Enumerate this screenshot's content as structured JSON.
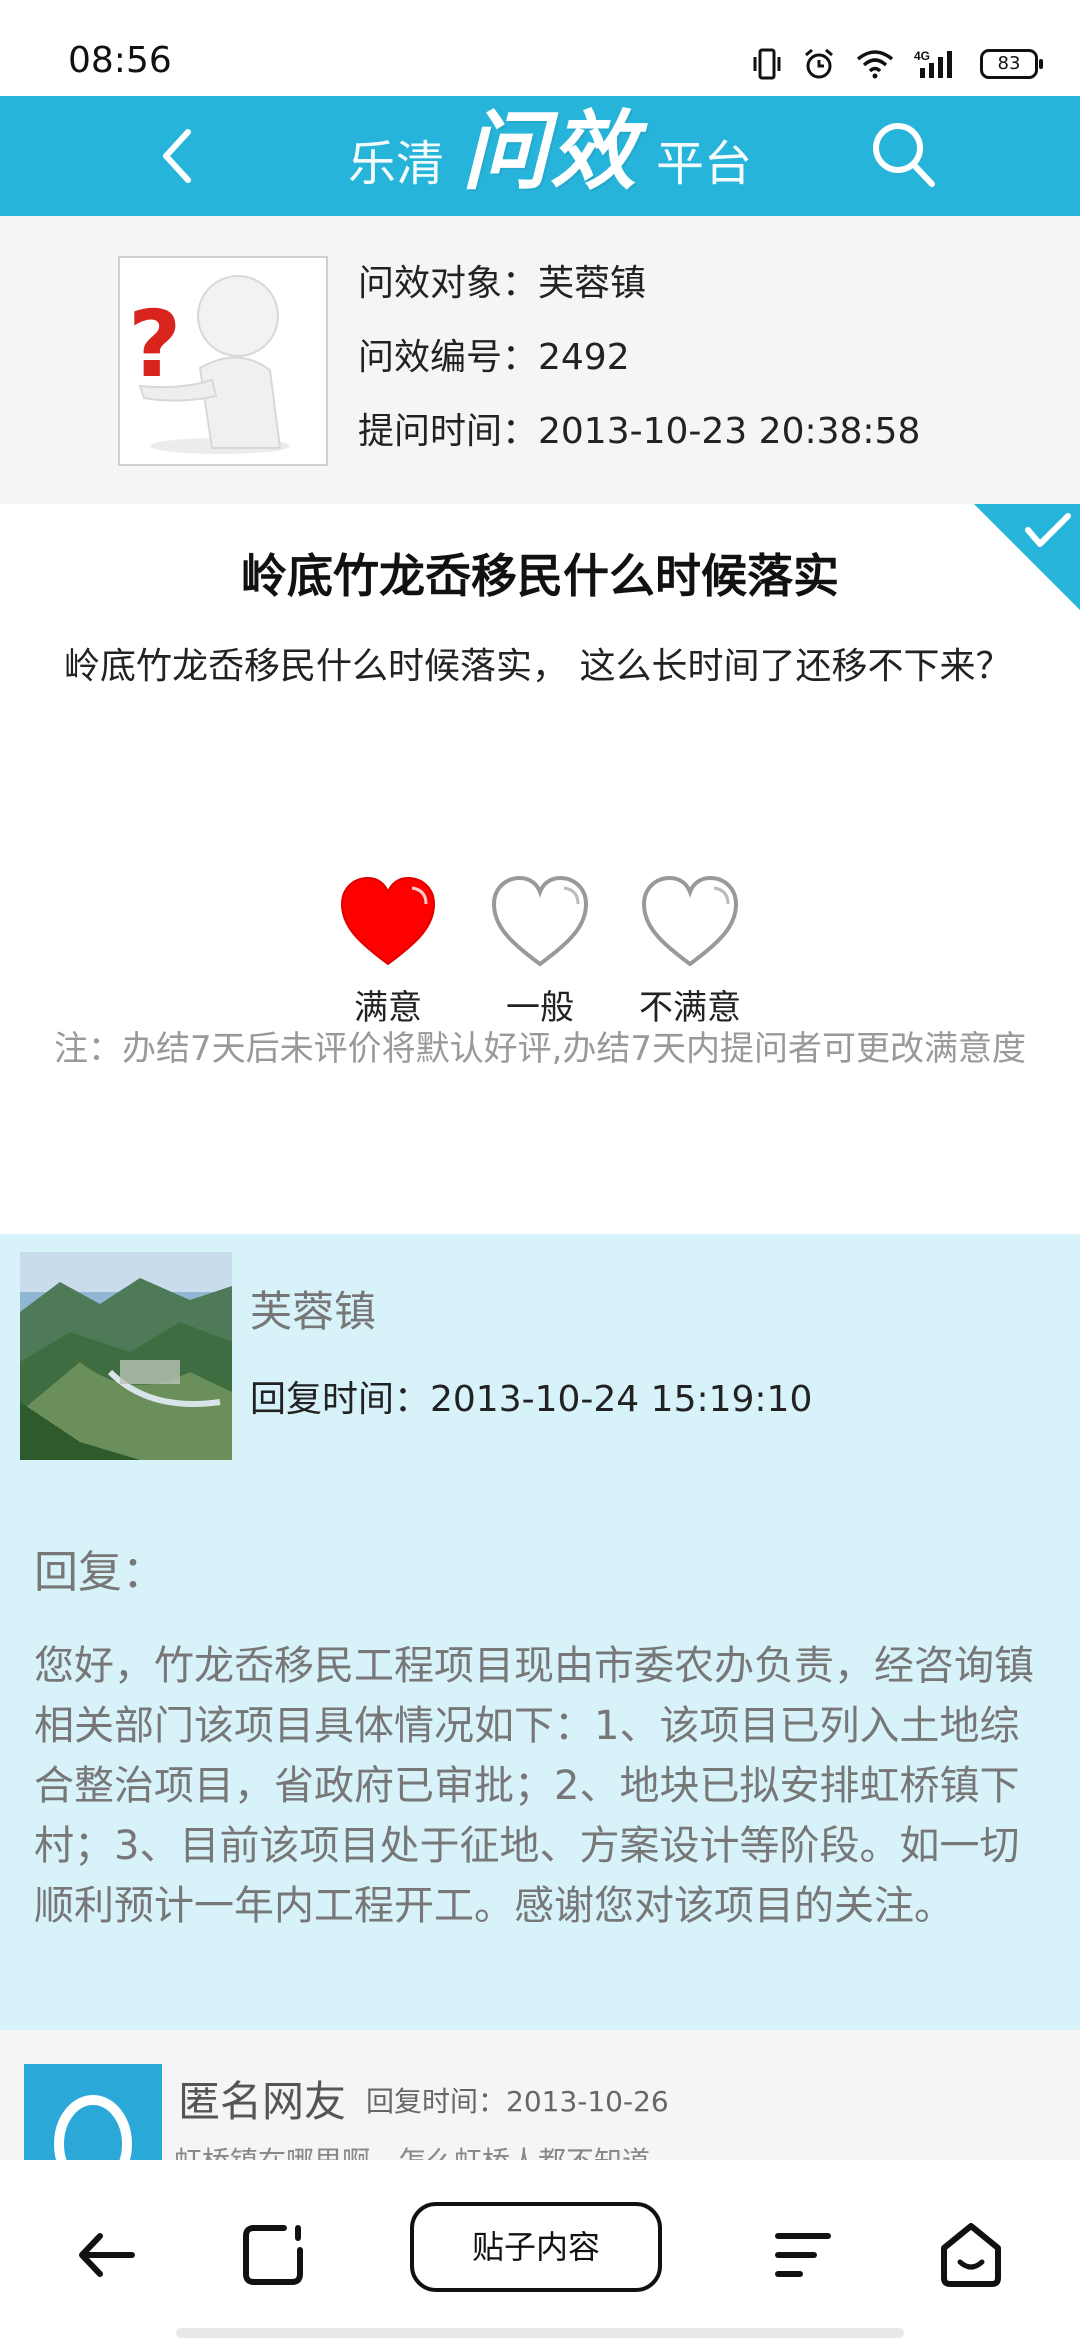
{
  "status_bar": {
    "time": "08:56",
    "battery": "83"
  },
  "header": {
    "logo_prefix": "乐清",
    "logo_main": "问效",
    "logo_suffix": "平台"
  },
  "info": {
    "target": "问效对象：芙蓉镇",
    "number": "问效编号：2492",
    "time": "提问时间：2013-10-23 20:38:58"
  },
  "question": {
    "title": "岭底竹龙岙移民什么时候落实",
    "body": "岭底竹龙岙移民什么时候落实， 这么长时间了还移不下来？"
  },
  "rating": {
    "options": [
      "满意",
      "一般",
      "不满意"
    ],
    "selected_index": 0,
    "note": "注：办结7天后未评价将默认好评,办结7天内提问者可更改满意度"
  },
  "reply": {
    "name": "芙蓉镇",
    "time": "回复时间：2013-10-24 15:19:10",
    "heading": "回复：",
    "text": "您好，竹龙岙移民工程项目现由市委农办负责，经咨询镇相关部门该项目具体情况如下：1、该项目已列入土地综合整治项目，省政府已审批；2、地块已拟安排虹桥镇下村；3、目前该项目处于征地、方案设计等阶段。如一切顺利预计一年内工程开工。感谢您对该项目的关注。"
  },
  "comment": {
    "name": "匿名网友",
    "time": "回复时间：2013-10-26",
    "text": "虹桥镇在哪里啊，怎么虹桥人都不知道"
  },
  "bottom_nav": {
    "center_label": "贴子内容"
  },
  "colors": {
    "header": "#27b4da",
    "reply_bg": "#d8f2f9",
    "selected_heart": "#ff0000"
  }
}
